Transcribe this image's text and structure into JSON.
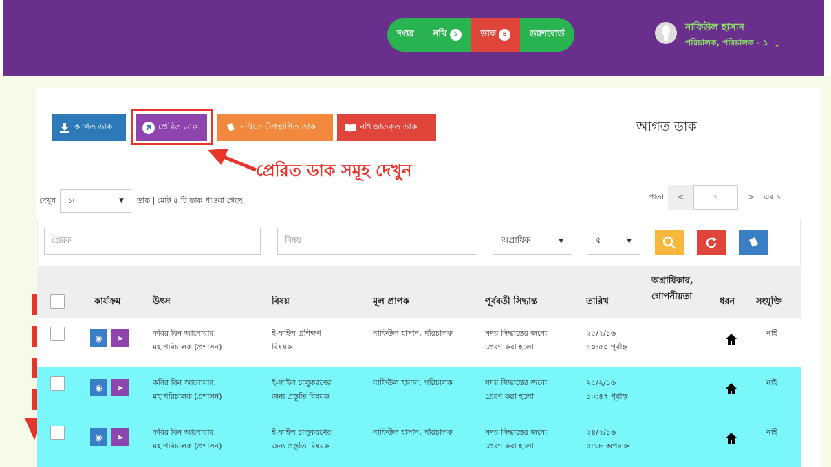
{
  "header": {
    "nav": [
      {
        "label": "দপ্তর",
        "badge": ""
      },
      {
        "label": "নথি",
        "badge": "১"
      },
      {
        "label": "ডাক",
        "badge": "৪"
      },
      {
        "label": "ড্যাশবোর্ড",
        "badge": ""
      }
    ],
    "user_name": "নাফিউল হাসান",
    "user_role": "পরিচালক, পরিচালক - ১"
  },
  "tabs": {
    "inbox": "আগত ডাক",
    "sent": "প্রেরিত ডাক",
    "nothi": "নথিতে উপস্থাপিত ডাক",
    "archived": "নথিজাতকৃত ডাক"
  },
  "section_title": "আগত ডাক",
  "annotation": "প্রেরিত ডাক সমূহ দেখুন",
  "length": {
    "prefix": "দেখুন",
    "value": "১০",
    "suffix": "ডাক | মোট ৫ টি ডাক পাওয়া গেছে"
  },
  "pager": {
    "label": "পাতা",
    "page": "১",
    "suffix": "এর ১"
  },
  "filters": {
    "sender_placeholder": "প্রেরক",
    "subject_placeholder": "বিষয়",
    "priority": "অগ্রাধিক",
    "count": "৫"
  },
  "table": {
    "headers": {
      "action": "কার্যক্রম",
      "source": "উৎস",
      "subject": "বিষয়",
      "receiver": "মূল প্রাপক",
      "decision": "পূর্ববর্তী সিদ্ধান্ত",
      "date": "তারিখ",
      "priority": "অগ্রাধিকার, গোপনীয়তা",
      "type": "ধরন",
      "attachment": "সংযুক্তি"
    },
    "rows": [
      {
        "source": [
          "কবির বিন আনোয়ার,",
          "মহাপরিচালক (প্রশাসন)"
        ],
        "subject": [
          "ই-ফাইল প্রশিক্ষণ",
          "বিষয়ক"
        ],
        "receiver": "নাফিউল হাসান, পরিচালক",
        "decision": [
          "সদয় সিদ্ধান্তের জন্যে",
          "প্রেরণ করা হলো"
        ],
        "date": [
          "২৫/২/১৬",
          "১০:৫০ পূর্বাহ্ন"
        ],
        "attachment": "নাই"
      },
      {
        "source": [
          "কবির বিন আনোয়ার,",
          "মহাপরিচালক (প্রশাসন)"
        ],
        "subject": [
          "ই-ফাইল চালুকরণের",
          "জন্য প্রস্তুতি বিষয়ক"
        ],
        "receiver": "নাফিউল হাসান, পরিচালক",
        "decision": [
          "সদয় সিদ্ধান্তের জন্যে",
          "প্রেরণ করা হলো"
        ],
        "date": [
          "২৫/২/১৬",
          "১০:৪৭ পূর্বাহ্ন"
        ],
        "attachment": "নাই"
      },
      {
        "source": [
          "কবির বিন আনোয়ার,",
          "মহাপরিচালক (প্রশাসন)"
        ],
        "subject": [
          "ই-ফাইল চালুকরণের",
          "জন্য প্রস্তুতি বিষয়ক"
        ],
        "receiver": "নাফিউল হাসান, পরিচালক",
        "decision": [
          "সদয় সিদ্ধান্তের জন্যে",
          "প্রেরণ করা হলো"
        ],
        "date": [
          "২৪/২/১৬",
          "৫:১৮ অপরাহ্ন"
        ],
        "attachment": "নাই"
      }
    ]
  },
  "colors": {
    "header_bg": "#6a2f8d",
    "nav_green": "#2ab451",
    "nav_active": "#e0453b",
    "row_highlight": "#7af7fb",
    "annotation_red": "#e8342a"
  }
}
